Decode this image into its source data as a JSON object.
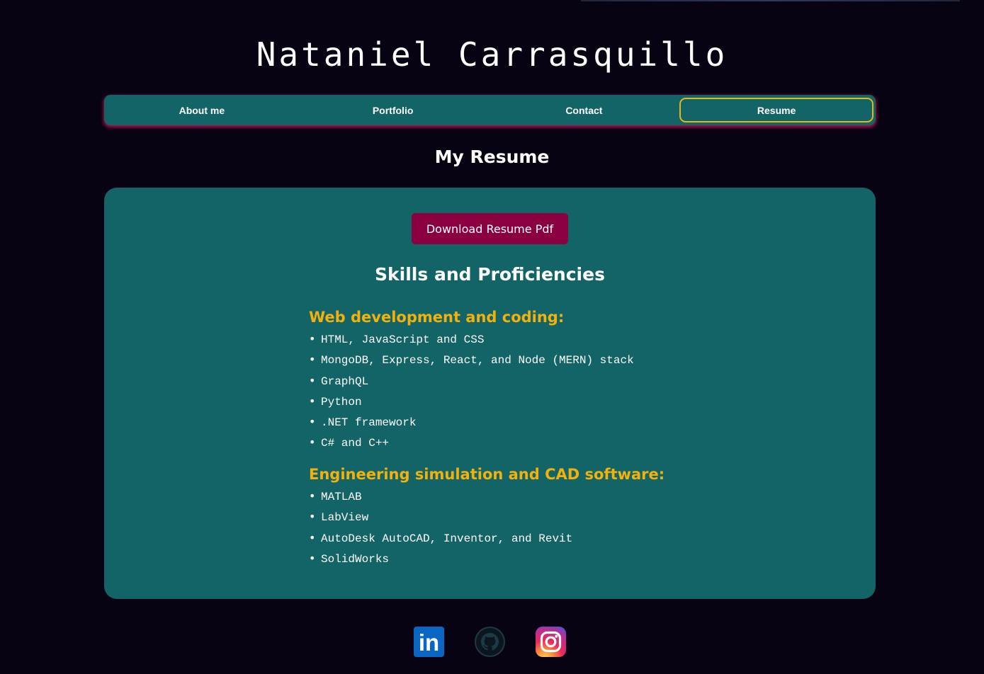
{
  "site_title": "Nataniel Carrasquillo",
  "nav": {
    "items": [
      {
        "label": "About me"
      },
      {
        "label": "Portfolio"
      },
      {
        "label": "Contact"
      },
      {
        "label": "Resume",
        "active": true
      }
    ]
  },
  "page_heading": "My Resume",
  "resume": {
    "download_label": "Download Resume Pdf",
    "skills_heading": "Skills and Proficiencies",
    "categories": [
      {
        "title": "Web development and coding:",
        "items": [
          "HTML, JavaScript and CSS",
          "MongoDB, Express, React, and Node (MERN) stack",
          "GraphQL",
          "Python",
          ".NET framework",
          "C# and C++"
        ]
      },
      {
        "title": "Engineering simulation and CAD software:",
        "items": [
          "MATLAB",
          "LabView",
          "AutoDesk AutoCAD, Inventor, and Revit",
          "SolidWorks"
        ]
      }
    ]
  },
  "social": [
    {
      "icon": "linkedin-icon",
      "label": "in"
    },
    {
      "icon": "github-icon"
    },
    {
      "icon": "instagram-icon"
    }
  ],
  "colors": {
    "background": "#070312",
    "teal": "#136466",
    "accent_pink": "#b0104f",
    "button": "#8b0040",
    "highlight_yellow": "#f3b10c"
  }
}
